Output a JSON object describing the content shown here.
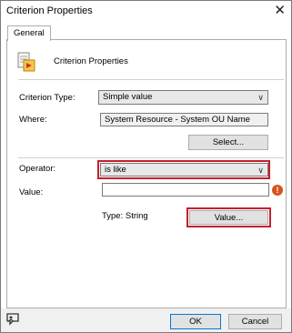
{
  "window": {
    "title": "Criterion Properties",
    "close_glyph": "✕"
  },
  "tabs": [
    {
      "label": "General"
    }
  ],
  "header": {
    "title": "Criterion Properties",
    "icon": "criterion-properties-icon"
  },
  "form": {
    "criterion_type": {
      "label": "Criterion Type:",
      "value": "Simple value"
    },
    "where": {
      "label": "Where:",
      "value": "System Resource - System OU Name"
    },
    "select_button": "Select...",
    "operator": {
      "label": "Operator:",
      "value": "is like"
    },
    "value": {
      "label": "Value:",
      "input_value": ""
    },
    "warning_icon_glyph": "!",
    "type_text": "Type: String",
    "value_button": "Value..."
  },
  "footer": {
    "ok_label": "OK",
    "cancel_label": "Cancel",
    "icon": "feedback-icon"
  },
  "colors": {
    "highlight_red": "#c4202c",
    "warning_orange": "#d9531e"
  }
}
